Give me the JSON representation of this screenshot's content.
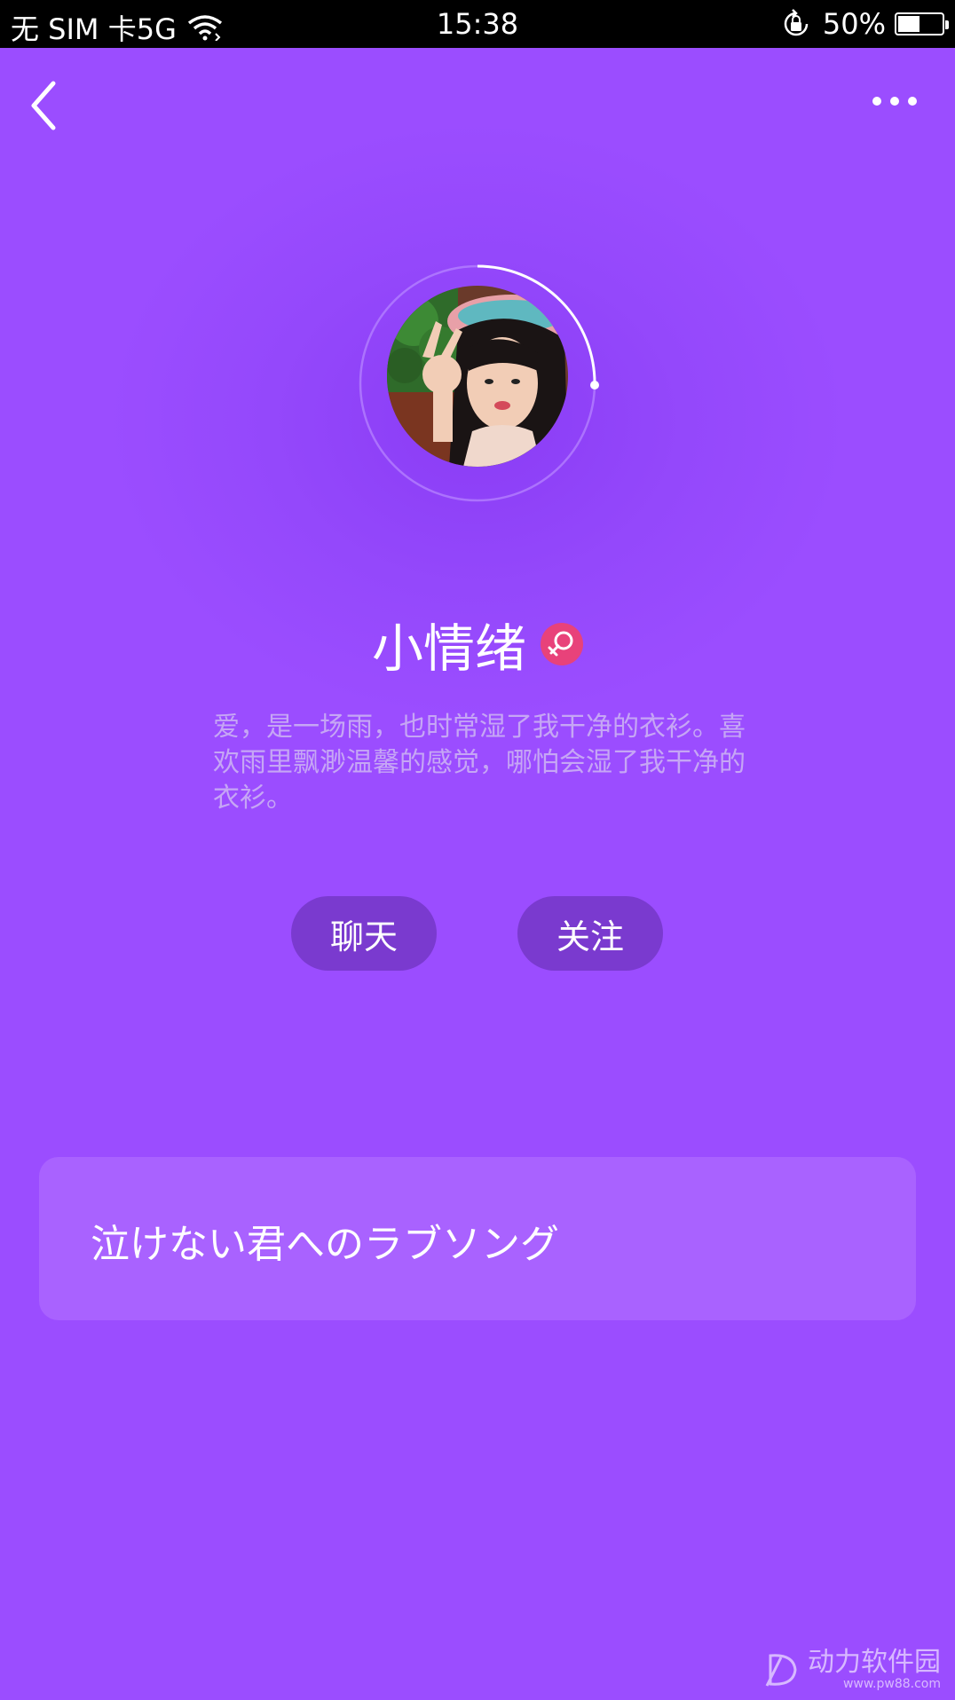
{
  "status_bar": {
    "carrier": "无 SIM 卡5G",
    "time": "15:38",
    "battery_percent": "50%",
    "battery_level": 0.5,
    "icons": [
      "wifi-icon",
      "rotation-lock-icon",
      "battery-icon"
    ]
  },
  "header": {
    "back_icon": "chevron-left-icon",
    "more_icon": "more-dots-icon"
  },
  "profile": {
    "name": "小情绪",
    "gender_icon": "female-icon",
    "gender_color": "#e8427a",
    "bio": "爱，是一场雨，也时常湿了我干净的衣衫。喜欢雨里飘渺温馨的感觉，哪怕会湿了我干净的衣衫。"
  },
  "actions": {
    "chat_label": "聊天",
    "follow_label": "关注"
  },
  "song": {
    "title": "泣けない君へのラブソング"
  },
  "watermark": {
    "title": "动力软件园",
    "url": "www.pw88.com"
  },
  "colors": {
    "background": "#9b4dff",
    "button": "#7a3acf",
    "card": "#a962ff",
    "bio_text": "#c6a6f5"
  }
}
